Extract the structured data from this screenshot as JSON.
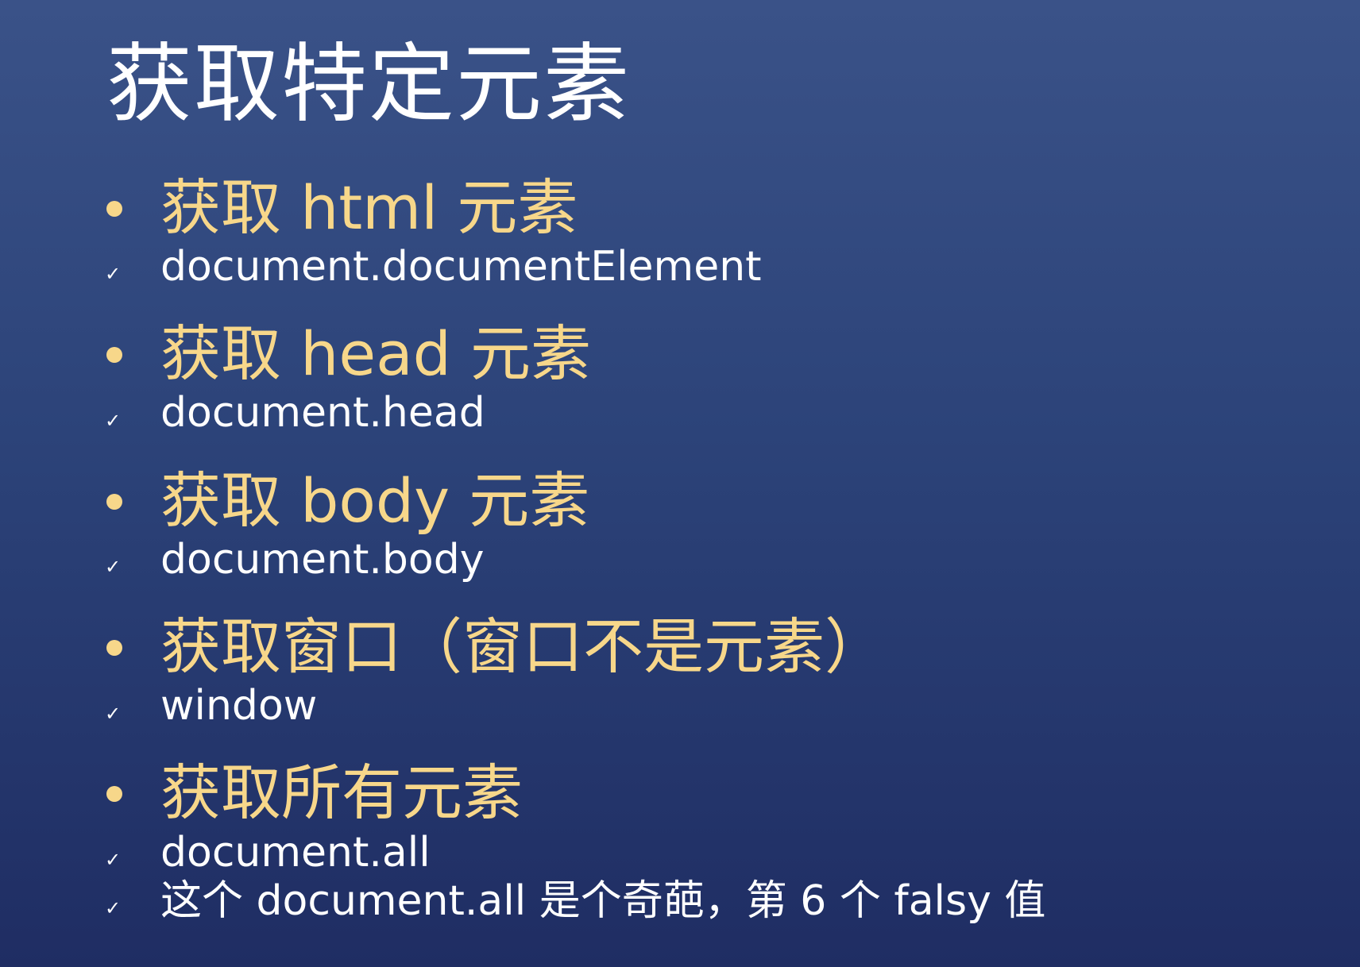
{
  "slide": {
    "title": "获取特定元素",
    "items": [
      {
        "heading": "获取 html 元素",
        "notes": [
          "document.documentElement"
        ]
      },
      {
        "heading": "获取 head 元素",
        "notes": [
          "document.head"
        ]
      },
      {
        "heading": "获取 body 元素",
        "notes": [
          "document.body"
        ]
      },
      {
        "heading": "获取窗口（窗口不是元素）",
        "notes": [
          "window"
        ]
      },
      {
        "heading": "获取所有元素",
        "notes": [
          "document.all",
          "这个 document.all 是个奇葩，第 6 个 falsy 值"
        ]
      }
    ],
    "bullet_icon": "dot-bullet",
    "check_icon": "check-mark",
    "colors": {
      "heading": "#f7d78a",
      "text": "#ffffff",
      "background_top": "#3a5288",
      "background_bottom": "#1f2d63"
    }
  }
}
